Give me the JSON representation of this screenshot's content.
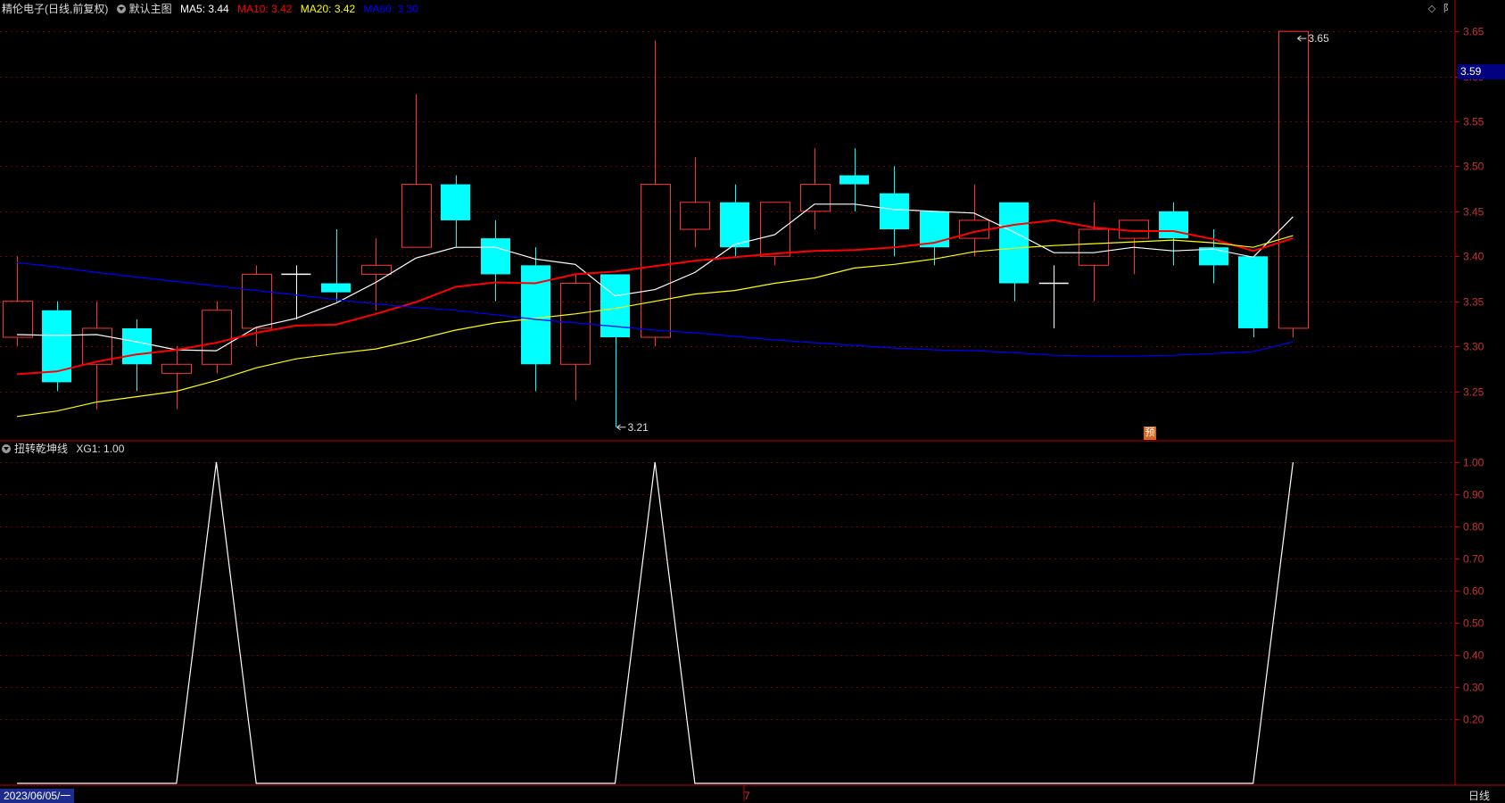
{
  "header": {
    "stock_title": "精伦电子(日线,前复权)",
    "main_chart_label": "默认主图",
    "ma5": "MA5: 3.44",
    "ma10": "MA10: 3.42",
    "ma20": "MA20: 3.42",
    "ma60": "MA60: 3.30"
  },
  "indicator_header": {
    "name": "扭转乾坤线",
    "value": "XG1: 1.00"
  },
  "corner_buttons": {
    "diamond": "◇",
    "settings": "阝"
  },
  "price_tag": "3.59",
  "high_label": "3.65",
  "low_label": "3.21",
  "pre_badge": "预",
  "footer": {
    "date": "2023/06/05/一",
    "x_tick": "7",
    "period": "日线"
  },
  "colors": {
    "up": "#ff3232",
    "down": "#00ffff",
    "ma5": "#ffffff",
    "ma10": "#ff0000",
    "ma20": "#ffff00",
    "ma60": "#0000ff",
    "axis": "#c00000",
    "grid": "#7a0000"
  },
  "chart_data": [
    {
      "type": "candlestick",
      "title": "精伦电子(日线,前复权)",
      "ylim": [
        3.195,
        3.665
      ],
      "y_ticks": [
        "3.25",
        "3.30",
        "3.35",
        "3.40",
        "3.45",
        "3.50",
        "3.55",
        "3.60",
        "3.65"
      ],
      "candles": [
        {
          "o": 3.31,
          "h": 3.4,
          "l": 3.3,
          "c": 3.35
        },
        {
          "o": 3.34,
          "h": 3.35,
          "l": 3.25,
          "c": 3.26
        },
        {
          "o": 3.28,
          "h": 3.35,
          "l": 3.23,
          "c": 3.32
        },
        {
          "o": 3.32,
          "h": 3.33,
          "l": 3.25,
          "c": 3.28
        },
        {
          "o": 3.27,
          "h": 3.3,
          "l": 3.23,
          "c": 3.28
        },
        {
          "o": 3.28,
          "h": 3.35,
          "l": 3.27,
          "c": 3.34
        },
        {
          "o": 3.32,
          "h": 3.39,
          "l": 3.3,
          "c": 3.38
        },
        {
          "o": 3.38,
          "h": 3.39,
          "l": 3.33,
          "c": 3.38
        },
        {
          "o": 3.37,
          "h": 3.43,
          "l": 3.35,
          "c": 3.36
        },
        {
          "o": 3.38,
          "h": 3.42,
          "l": 3.34,
          "c": 3.39
        },
        {
          "o": 3.41,
          "h": 3.58,
          "l": 3.41,
          "c": 3.48
        },
        {
          "o": 3.48,
          "h": 3.49,
          "l": 3.41,
          "c": 3.44
        },
        {
          "o": 3.42,
          "h": 3.44,
          "l": 3.35,
          "c": 3.38
        },
        {
          "o": 3.39,
          "h": 3.41,
          "l": 3.25,
          "c": 3.28
        },
        {
          "o": 3.28,
          "h": 3.38,
          "l": 3.24,
          "c": 3.37
        },
        {
          "o": 3.38,
          "h": 3.38,
          "l": 3.21,
          "c": 3.31
        },
        {
          "o": 3.31,
          "h": 3.64,
          "l": 3.3,
          "c": 3.48
        },
        {
          "o": 3.43,
          "h": 3.51,
          "l": 3.41,
          "c": 3.46
        },
        {
          "o": 3.46,
          "h": 3.48,
          "l": 3.4,
          "c": 3.41
        },
        {
          "o": 3.4,
          "h": 3.46,
          "l": 3.39,
          "c": 3.46
        },
        {
          "o": 3.45,
          "h": 3.52,
          "l": 3.43,
          "c": 3.48
        },
        {
          "o": 3.49,
          "h": 3.52,
          "l": 3.45,
          "c": 3.48
        },
        {
          "o": 3.47,
          "h": 3.5,
          "l": 3.4,
          "c": 3.43
        },
        {
          "o": 3.45,
          "h": 3.45,
          "l": 3.39,
          "c": 3.41
        },
        {
          "o": 3.42,
          "h": 3.48,
          "l": 3.4,
          "c": 3.44
        },
        {
          "o": 3.46,
          "h": 3.46,
          "l": 3.35,
          "c": 3.37
        },
        {
          "o": 3.37,
          "h": 3.39,
          "l": 3.32,
          "c": 3.37
        },
        {
          "o": 3.39,
          "h": 3.46,
          "l": 3.35,
          "c": 3.43
        },
        {
          "o": 3.42,
          "h": 3.44,
          "l": 3.38,
          "c": 3.44
        },
        {
          "o": 3.45,
          "h": 3.46,
          "l": 3.39,
          "c": 3.42
        },
        {
          "o": 3.41,
          "h": 3.43,
          "l": 3.37,
          "c": 3.39
        },
        {
          "o": 3.4,
          "h": 3.4,
          "l": 3.31,
          "c": 3.32
        },
        {
          "o": 3.32,
          "h": 3.65,
          "l": 3.31,
          "c": 3.65
        }
      ],
      "series": [
        {
          "name": "MA5",
          "color": "#ffffff",
          "values": [
            3.313,
            3.312,
            3.313,
            3.305,
            3.296,
            3.295,
            3.321,
            3.331,
            3.348,
            3.371,
            3.398,
            3.41,
            3.41,
            3.397,
            3.391,
            3.356,
            3.363,
            3.382,
            3.413,
            3.424,
            3.458,
            3.458,
            3.452,
            3.45,
            3.448,
            3.427,
            3.404,
            3.404,
            3.41,
            3.406,
            3.408,
            3.399,
            3.444
          ]
        },
        {
          "name": "MA10",
          "color": "#ff0000",
          "values": [
            3.269,
            3.272,
            3.283,
            3.291,
            3.296,
            3.304,
            3.315,
            3.323,
            3.324,
            3.336,
            3.349,
            3.366,
            3.371,
            3.37,
            3.38,
            3.383,
            3.389,
            3.395,
            3.399,
            3.403,
            3.406,
            3.407,
            3.41,
            3.415,
            3.427,
            3.435,
            3.44,
            3.432,
            3.428,
            3.428,
            3.419,
            3.406,
            3.42
          ]
        },
        {
          "name": "MA20",
          "color": "#ffff00",
          "values": [
            3.222,
            3.228,
            3.238,
            3.244,
            3.25,
            3.262,
            3.276,
            3.286,
            3.292,
            3.297,
            3.307,
            3.318,
            3.326,
            3.331,
            3.336,
            3.342,
            3.35,
            3.358,
            3.362,
            3.37,
            3.376,
            3.387,
            3.391,
            3.397,
            3.405,
            3.409,
            3.412,
            3.414,
            3.416,
            3.418,
            3.415,
            3.41,
            3.423
          ]
        },
        {
          "name": "MA60",
          "color": "#0000ff",
          "values": [
            3.393,
            3.388,
            3.382,
            3.377,
            3.372,
            3.367,
            3.362,
            3.357,
            3.352,
            3.347,
            3.343,
            3.34,
            3.335,
            3.33,
            3.326,
            3.322,
            3.318,
            3.315,
            3.311,
            3.307,
            3.304,
            3.301,
            3.298,
            3.296,
            3.295,
            3.293,
            3.29,
            3.289,
            3.289,
            3.29,
            3.292,
            3.294,
            3.305
          ]
        }
      ]
    },
    {
      "type": "line",
      "title": "扭转乾坤线",
      "ylim": [
        0,
        1.0
      ],
      "y_ticks": [
        "0.20",
        "0.30",
        "0.40",
        "0.50",
        "0.60",
        "0.70",
        "0.80",
        "0.90",
        "1.00"
      ],
      "series": [
        {
          "name": "XG1",
          "color": "#ffffff",
          "values": [
            0,
            0,
            0,
            0,
            0,
            1,
            0,
            0,
            0,
            0,
            0,
            0,
            0,
            0,
            0,
            0,
            1,
            0,
            0,
            0,
            0,
            0,
            0,
            0,
            0,
            0,
            0,
            0,
            0,
            0,
            0,
            0,
            1
          ]
        }
      ]
    }
  ]
}
